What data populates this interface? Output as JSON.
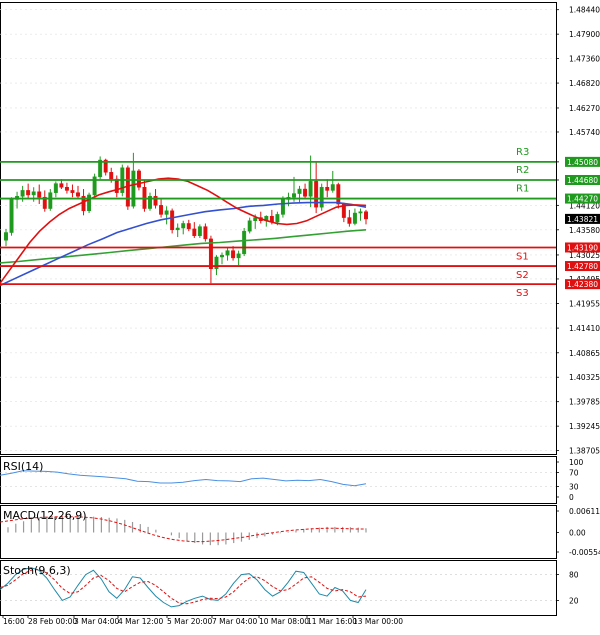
{
  "chart_data": {
    "type": "candlestick",
    "main": {
      "y_ticks": [
        "1.48440",
        "1.47900",
        "1.47360",
        "1.46820",
        "1.46270",
        "1.45740",
        "1.45080",
        "1.44680",
        "1.44120",
        "1.43580",
        "1.43025",
        "1.42495",
        "1.41955",
        "1.41410",
        "1.40865",
        "1.40325",
        "1.39785",
        "1.39245",
        "1.38705"
      ],
      "ylim": [
        1.3863,
        1.4861
      ],
      "current_price": "1.43821",
      "levels": [
        {
          "name": "R3",
          "price": "1.45080",
          "color": "#1f9a1f"
        },
        {
          "name": "R2",
          "price": "1.44680",
          "color": "#1f9a1f"
        },
        {
          "name": "R1",
          "price": "1.44270",
          "color": "#1f9a1f"
        },
        {
          "name": "S1",
          "price": "1.43190",
          "color": "#e01010"
        },
        {
          "name": "S2",
          "price": "1.42780",
          "color": "#e01010"
        },
        {
          "name": "S3",
          "price": "1.42380",
          "color": "#e01010"
        }
      ],
      "candles": [
        [
          1.4335,
          1.436,
          1.4322,
          1.4352
        ],
        [
          1.4352,
          1.443,
          1.4345,
          1.4425
        ],
        [
          1.4425,
          1.4442,
          1.4405,
          1.4432
        ],
        [
          1.4432,
          1.4455,
          1.442,
          1.4445
        ],
        [
          1.4445,
          1.446,
          1.4425,
          1.4435
        ],
        [
          1.4435,
          1.4452,
          1.442,
          1.4442
        ],
        [
          1.4442,
          1.4458,
          1.4415,
          1.443
        ],
        [
          1.443,
          1.4445,
          1.4398,
          1.4405
        ],
        [
          1.4405,
          1.4448,
          1.44,
          1.444
        ],
        [
          1.444,
          1.4465,
          1.443,
          1.446
        ],
        [
          1.446,
          1.447,
          1.4448,
          1.4452
        ],
        [
          1.4452,
          1.4462,
          1.4438,
          1.4445
        ],
        [
          1.4445,
          1.4458,
          1.443,
          1.444
        ],
        [
          1.444,
          1.4455,
          1.4425,
          1.4432
        ],
        [
          1.4432,
          1.4448,
          1.439,
          1.44
        ],
        [
          1.44,
          1.444,
          1.4395,
          1.4435
        ],
        [
          1.4435,
          1.4482,
          1.443,
          1.4475
        ],
        [
          1.4475,
          1.452,
          1.447,
          1.4512
        ],
        [
          1.4512,
          1.4515,
          1.4478,
          1.4485
        ],
        [
          1.4485,
          1.4495,
          1.4462,
          1.447
        ],
        [
          1.447,
          1.4478,
          1.443,
          1.444
        ],
        [
          1.444,
          1.4502,
          1.4432,
          1.4495
        ],
        [
          1.4495,
          1.45,
          1.4402,
          1.441
        ],
        [
          1.441,
          1.4528,
          1.4405,
          1.4488
        ],
        [
          1.4488,
          1.4492,
          1.4445,
          1.4452
        ],
        [
          1.4452,
          1.4468,
          1.4398,
          1.4405
        ],
        [
          1.4405,
          1.444,
          1.44,
          1.4432
        ],
        [
          1.4432,
          1.4448,
          1.4405,
          1.4412
        ],
        [
          1.4412,
          1.4428,
          1.4385,
          1.4392
        ],
        [
          1.4392,
          1.441,
          1.437,
          1.44
        ],
        [
          1.44,
          1.4405,
          1.435,
          1.4358
        ],
        [
          1.4358,
          1.4372,
          1.4342,
          1.4362
        ],
        [
          1.4362,
          1.4378,
          1.4348,
          1.4372
        ],
        [
          1.4372,
          1.438,
          1.4355,
          1.436
        ],
        [
          1.436,
          1.4375,
          1.434,
          1.4345
        ],
        [
          1.4345,
          1.437,
          1.434,
          1.4365
        ],
        [
          1.4365,
          1.4372,
          1.4332,
          1.4338
        ],
        [
          1.4338,
          1.4345,
          1.424,
          1.4272
        ],
        [
          1.4272,
          1.4302,
          1.4258,
          1.4298
        ],
        [
          1.4298,
          1.4308,
          1.4282,
          1.4302
        ],
        [
          1.4302,
          1.4318,
          1.429,
          1.4312
        ],
        [
          1.4312,
          1.4322,
          1.429,
          1.4296
        ],
        [
          1.4296,
          1.4312,
          1.428,
          1.4305
        ],
        [
          1.4305,
          1.4362,
          1.43,
          1.4355
        ],
        [
          1.4355,
          1.4385,
          1.435,
          1.4378
        ],
        [
          1.4378,
          1.4392,
          1.436,
          1.4385
        ],
        [
          1.4385,
          1.4398,
          1.4372,
          1.4378
        ],
        [
          1.4378,
          1.439,
          1.4365,
          1.4388
        ],
        [
          1.4388,
          1.4402,
          1.437,
          1.4375
        ],
        [
          1.4375,
          1.4398,
          1.4368,
          1.4392
        ],
        [
          1.4392,
          1.4432,
          1.4385,
          1.4425
        ],
        [
          1.4425,
          1.444,
          1.441,
          1.443
        ],
        [
          1.443,
          1.4475,
          1.442,
          1.4438
        ],
        [
          1.4438,
          1.4455,
          1.4418,
          1.4448
        ],
        [
          1.4448,
          1.446,
          1.4425,
          1.4432
        ],
        [
          1.4432,
          1.4522,
          1.4408,
          1.4465
        ],
        [
          1.4465,
          1.451,
          1.4395,
          1.4408
        ],
        [
          1.4408,
          1.446,
          1.44,
          1.4452
        ],
        [
          1.4452,
          1.447,
          1.443,
          1.4445
        ],
        [
          1.4445,
          1.4488,
          1.444,
          1.4458
        ],
        [
          1.4458,
          1.4462,
          1.4405,
          1.4415
        ],
        [
          1.4415,
          1.4418,
          1.4375,
          1.4385
        ],
        [
          1.4385,
          1.4402,
          1.4365,
          1.4372
        ],
        [
          1.4372,
          1.4405,
          1.4368,
          1.4395
        ],
        [
          1.4395,
          1.4405,
          1.4378,
          1.4398
        ],
        [
          1.4398,
          1.4402,
          1.437,
          1.4382
        ]
      ],
      "ma_red": [
        1.424,
        1.427,
        1.43,
        1.433,
        1.4355,
        1.4375,
        1.4392,
        1.4405,
        1.4415,
        1.4425,
        1.4435,
        1.4442,
        1.4448,
        1.4455,
        1.446,
        1.4465,
        1.447,
        1.4472,
        1.447,
        1.4465,
        1.4455,
        1.4445,
        1.4432,
        1.4418,
        1.4405,
        1.4395,
        1.4385,
        1.4378,
        1.4372,
        1.437,
        1.4372,
        1.4378,
        1.4388,
        1.4398,
        1.4408,
        1.4412,
        1.4413,
        1.4412
      ],
      "ma_blue": [
        1.4235,
        1.425,
        1.4265,
        1.428,
        1.4295,
        1.431,
        1.4325,
        1.4338,
        1.4352,
        1.4362,
        1.4372,
        1.438,
        1.4386,
        1.4392,
        1.4398,
        1.4402,
        1.4405,
        1.441,
        1.4412,
        1.4415,
        1.4417,
        1.4418,
        1.4418,
        1.4418,
        1.4414,
        1.4408
      ],
      "ma_green": [
        1.4285,
        1.4288,
        1.4292,
        1.4296,
        1.43,
        1.4304,
        1.4308,
        1.4312,
        1.4316,
        1.432,
        1.4324,
        1.4328,
        1.433,
        1.4333,
        1.4336,
        1.4339,
        1.4343,
        1.4347,
        1.4351,
        1.4355,
        1.4358
      ]
    },
    "panes": [
      {
        "title": "RSI(14)",
        "y_ticks": [
          "100",
          "70",
          "30",
          "0"
        ],
        "ylim": [
          0,
          100
        ],
        "values": [
          62,
          68,
          75,
          74,
          73,
          71,
          66,
          62,
          60,
          58,
          55,
          52,
          45,
          44,
          40,
          40,
          42,
          47,
          50,
          47,
          46,
          44,
          52,
          54,
          50,
          46,
          48,
          47,
          50,
          44,
          36,
          32,
          38
        ]
      },
      {
        "title": "MACD(12,26,9)",
        "y_ticks": [
          "0.006118",
          "0.00",
          "-0.005546"
        ],
        "ylim": [
          -0.005546,
          0.006118
        ],
        "histogram": [
          0.0015,
          0.0025,
          0.0032,
          0.0038,
          0.0042,
          0.0044,
          0.0045,
          0.0045,
          0.0046,
          0.0046,
          0.0045,
          0.0045,
          0.0044,
          0.0042,
          0.004,
          0.0036,
          0.003,
          0.0024,
          0.0016,
          0.0008,
          0.0,
          -0.0008,
          -0.0016,
          -0.0024,
          -0.003,
          -0.0034,
          -0.0036,
          -0.0036,
          -0.0034,
          -0.003,
          -0.0026,
          -0.0021,
          -0.0016,
          -0.0011,
          -0.0006,
          -0.0002,
          0.0002,
          0.0006,
          0.001,
          0.0012,
          0.0014,
          0.0016,
          0.0016,
          0.0016,
          0.0015,
          0.0014,
          0.0012
        ],
        "signal": [
          0.003,
          0.0034,
          0.0038,
          0.0041,
          0.0043,
          0.0044,
          0.0045,
          0.0045,
          0.0044,
          0.0042,
          0.0038,
          0.0032,
          0.0024,
          0.0014,
          0.0004,
          -0.0006,
          -0.0014,
          -0.002,
          -0.0024,
          -0.0026,
          -0.0026,
          -0.0024,
          -0.0021,
          -0.0017,
          -0.0013,
          -0.0008,
          -0.0004,
          0.0,
          0.0004,
          0.0007,
          0.0009,
          0.0011,
          0.0012,
          0.0012,
          0.0011,
          0.001,
          0.001
        ]
      },
      {
        "title": "Stoch(9,6,3)",
        "y_ticks": [
          "80",
          "20"
        ],
        "ylim": [
          0,
          100
        ],
        "main": [
          45,
          60,
          80,
          92,
          96,
          90,
          72,
          45,
          20,
          28,
          55,
          80,
          90,
          70,
          40,
          25,
          45,
          75,
          72,
          50,
          30,
          15,
          5,
          8,
          18,
          25,
          30,
          22,
          20,
          35,
          60,
          80,
          82,
          68,
          45,
          30,
          40,
          62,
          88,
          85,
          60,
          35,
          30,
          50,
          42,
          20,
          15,
          45
        ],
        "signal": [
          50,
          55,
          68,
          82,
          90,
          92,
          84,
          68,
          48,
          36,
          40,
          55,
          72,
          78,
          66,
          48,
          40,
          52,
          62,
          64,
          55,
          40,
          25,
          14,
          12,
          16,
          22,
          25,
          24,
          28,
          40,
          58,
          72,
          75,
          66,
          52,
          42,
          45,
          58,
          72,
          75,
          62,
          48,
          42,
          45,
          40,
          28,
          30
        ]
      }
    ],
    "x_ticks": [
      "16:00",
      "28 Feb 00:00",
      "3 Mar 04:00",
      "4 Mar 12:00",
      "5 Mar 20:00",
      "7 Mar 04:00",
      "10 Mar 08:00",
      "11 Mar 16:00",
      "13 Mar 00:00"
    ],
    "colors": {
      "up": "#1f9a1f",
      "down": "#e01010",
      "ma_red": "#e01010",
      "ma_blue": "#3350d0",
      "ma_green": "#33a033",
      "rsi": "#4a90e2",
      "macd_signal": "#e01010",
      "macd_hist": "#999999",
      "stoch_main": "#1f8aa8",
      "stoch_signal": "#e01010",
      "current_price_bg": "#000000",
      "grid": "#e0e0e0",
      "axis": "#000000"
    }
  }
}
